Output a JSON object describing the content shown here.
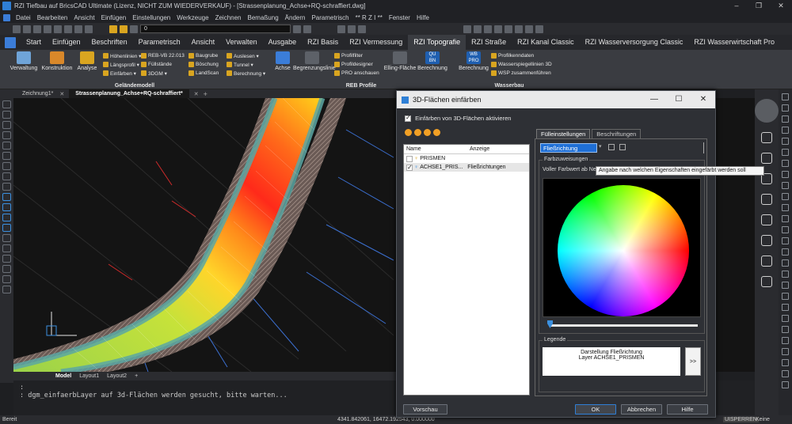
{
  "app": {
    "title": "RZI Tiefbau auf BricsCAD Ultimate (Lizenz, NICHT ZUM WIEDERVERKAUF) - [Strassenplanung_Achse+RQ-schraffiert.dwg]",
    "window_controls": [
      "–",
      "❐",
      "✕"
    ]
  },
  "menu": [
    "Datei",
    "Bearbeiten",
    "Ansicht",
    "Einfügen",
    "Einstellungen",
    "Werkzeuge",
    "Zeichnen",
    "Bemaßung",
    "Ändern",
    "Parametrisch",
    "** R Z I **",
    "Fenster",
    "Hilfe"
  ],
  "quick": {
    "layer_value": "0"
  },
  "ribbon_tabs": [
    "Start",
    "Einfügen",
    "Beschriften",
    "Parametrisch",
    "Ansicht",
    "Verwalten",
    "Ausgabe",
    "RZI Basis",
    "RZI Vermessung",
    "RZI Topografie",
    "RZI Straße",
    "RZI Kanal Classic",
    "RZI Wasserversorgung Classic",
    "RZI Wasserwirtschaft Pro"
  ],
  "ribbon": {
    "gelaende": {
      "title": "Geländemodell",
      "big": [
        "Verwaltung",
        "Konstruktion",
        "Analyse"
      ],
      "small": [
        "Höhenlinien ▾",
        "Längsprofil ▾",
        "Einfärben ▾",
        "REB-VB 22.013",
        "Füllstände",
        "3DGM ▾",
        "Baugrube",
        "Böschung",
        "LandScan",
        "Auslesen ▾",
        "Tunnel ▾",
        "Berechnung ▾"
      ]
    },
    "reb": {
      "title": "REB Profile",
      "big": [
        "Achse",
        "Begrenzungslinie",
        "Elling-Fläche",
        "Berechnung"
      ],
      "small": [
        "Profilfilter",
        "Profildesigner",
        "PRO anschauen"
      ],
      "badge": "QU BN"
    },
    "wasserbau": {
      "title": "Wasserbau",
      "big": [
        "Berechnung"
      ],
      "badge": "WB PRO",
      "small": [
        "Profilkenndaten",
        "Wasserspiegellinien 3D",
        "WSP zusammenführen"
      ]
    }
  },
  "doc_tabs": [
    "Zeichnung1*",
    "Strassenplanung_Achse+RQ-schraffiert*"
  ],
  "layout_tabs": [
    "Model",
    "Layout1",
    "Layout2",
    "+"
  ],
  "command_lines": [
    ":",
    ": dgm_einfaerbLayer auf 3d-Flächen werden gesucht, bitte warten..."
  ],
  "status": {
    "left": "Bereit",
    "coords": "4341.842061, 16472.192543, 0.000000",
    "right1": "UISPERREN",
    "right2": "Keine"
  },
  "dialog": {
    "title": "3D-Flächen einfärben",
    "activate_label": "Einfärben von 3D-Flächen aktivieren",
    "list_headers": [
      "Name",
      "Anzeige"
    ],
    "rows": [
      {
        "name": "PRISMEN",
        "display": ""
      },
      {
        "name": "ACHSE1_PRIS...",
        "display": "Fließrichtungen"
      }
    ],
    "tabs": [
      "Fülleinstellungen",
      "Beschriftungen"
    ],
    "property_value": "Fließrichtung",
    "farbzuweisungen_label": "Farbzuweisungen",
    "full_color_label": "Voller Farbwert ab Neig",
    "tooltip": "Angabe nach welchen Eigenschaften eingefärbt werden soll",
    "legend_label": "Legende",
    "legend_text_1": "Darstellung Fließrichtung",
    "legend_text_2": "Layer ACHSE1_PRISMEN",
    "legend_button": ">>",
    "buttons": {
      "preview": "Vorschau",
      "ok": "OK",
      "cancel": "Abbrechen",
      "help": "Hilfe"
    },
    "ctl": [
      "—",
      "☐",
      "✕"
    ]
  },
  "colors": {
    "accent": "#2f7fd6",
    "ribbon_bg": "#3a3c41",
    "canvas_bg": "#141414"
  }
}
